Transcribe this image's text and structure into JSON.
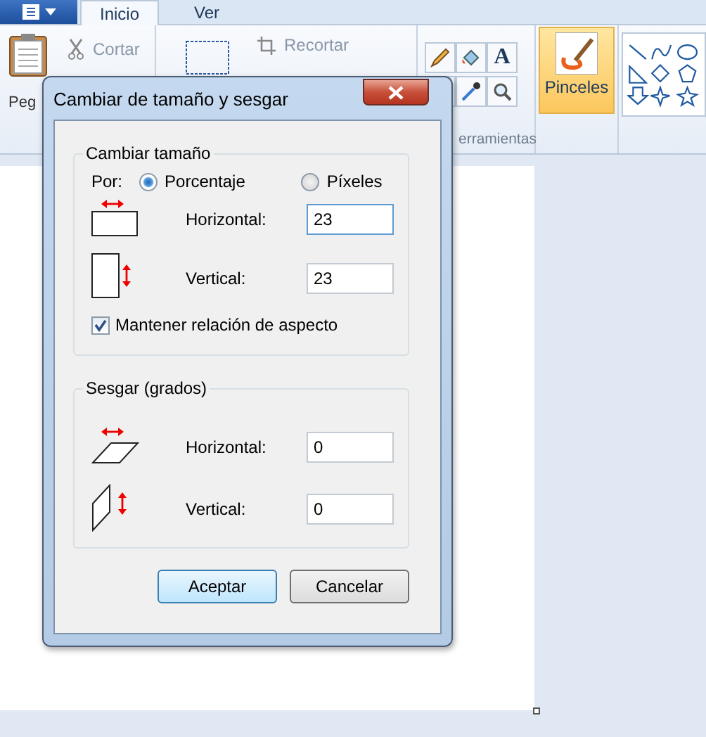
{
  "ribbon": {
    "tabs": [
      {
        "label": "Inicio",
        "selected": true
      },
      {
        "label": "Ver",
        "selected": false
      }
    ],
    "clipboard": {
      "paste_label": "Peg",
      "cut_label": "Cortar"
    },
    "image": {
      "crop_label": "Recortar"
    },
    "tools": {
      "text_tool": "A",
      "group_label": "erramientas"
    },
    "brushes": {
      "label": "Pinceles",
      "selected": true
    }
  },
  "dialog": {
    "title": "Cambiar de tamaño y sesgar",
    "resize": {
      "legend": "Cambiar tamaño",
      "by_label": "Por:",
      "units": [
        {
          "label": "Porcentaje",
          "selected": true
        },
        {
          "label": "Píxeles",
          "selected": false
        }
      ],
      "horizontal": {
        "label": "Horizontal:",
        "value": "23",
        "focused": true
      },
      "vertical": {
        "label": "Vertical:",
        "value": "23",
        "focused": false
      },
      "keep_aspect": {
        "label": "Mantener relación de aspecto",
        "checked": true
      }
    },
    "skew": {
      "legend": "Sesgar (grados)",
      "horizontal": {
        "label": "Horizontal:",
        "value": "0",
        "focused": false
      },
      "vertical": {
        "label": "Vertical:",
        "value": "0",
        "focused": false
      }
    },
    "buttons": [
      {
        "label": "Aceptar",
        "default": true
      },
      {
        "label": "Cancelar",
        "default": false
      }
    ]
  }
}
